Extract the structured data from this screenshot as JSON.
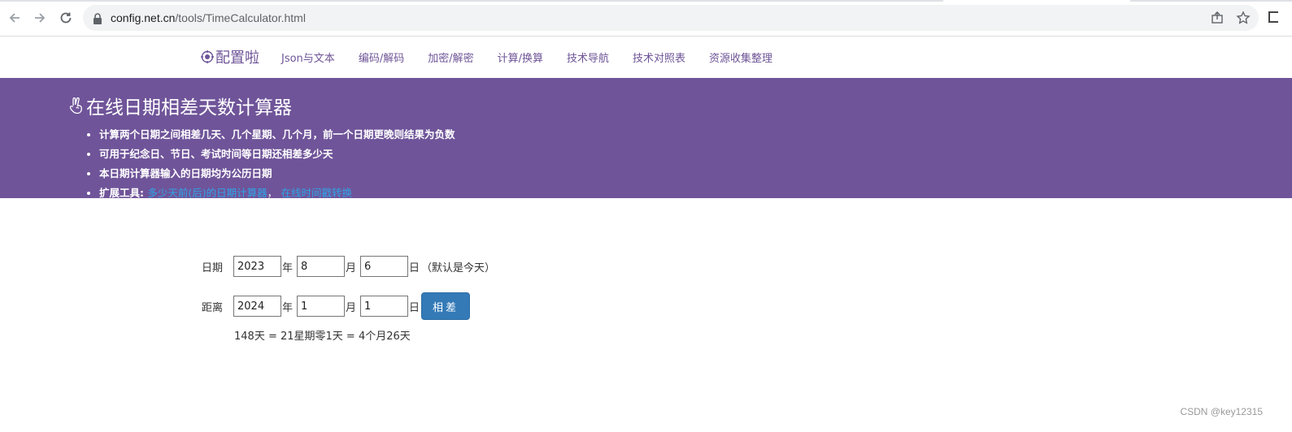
{
  "browser": {
    "url_host": "config.net.cn",
    "url_path": "/tools/TimeCalculator.html"
  },
  "site": {
    "brand": "配置啦",
    "nav": [
      "Json与文本",
      "编码/解码",
      "加密/解密",
      "计算/换算",
      "技术导航",
      "技术对照表",
      "资源收集整理"
    ]
  },
  "banner": {
    "title": "在线日期相差天数计算器",
    "bullets": [
      "计算两个日期之间相差几天、几个星期、几个月，前一个日期更晚则结果为负数",
      "可用于纪念日、节日、考试时间等日期还相差多少天",
      "本日期计算器输入的日期均为公历日期"
    ],
    "ext_label": "扩展工具",
    "ext_colon": ":",
    "ext_link1": "多少天前(后)的日期计算器",
    "ext_sep": "，",
    "ext_link2": "在线时间戳转换"
  },
  "calc": {
    "row1_label": "日期",
    "row1_year": "2023",
    "row1_month": "8",
    "row1_day": "6",
    "row2_label": "距离",
    "row2_year": "2024",
    "row2_month": "1",
    "row2_day": "1",
    "unit_year": "年",
    "unit_month": "月",
    "unit_day": "日",
    "default_hint": "（默认是今天）",
    "button": "相差",
    "result": "148天 = 21星期零1天 = 4个月26天"
  },
  "watermark": "CSDN @key12315",
  "colors": {
    "banner": "#6f5499",
    "link": "#2fa4e7",
    "button": "#337ab7",
    "brand": "#6e5497"
  }
}
